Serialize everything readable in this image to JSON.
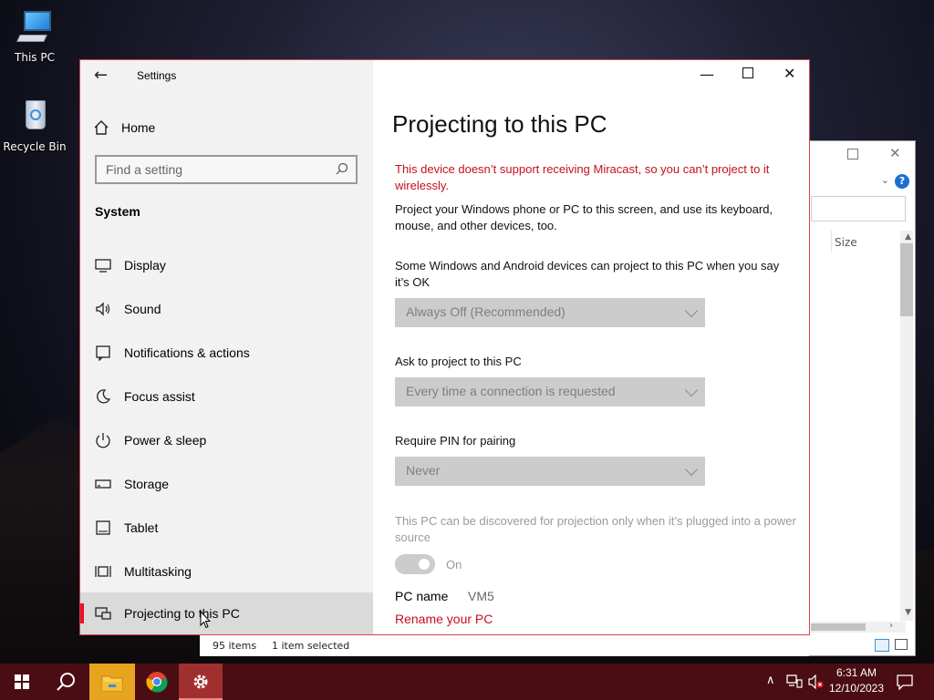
{
  "desktop": {
    "icons": [
      {
        "label": "This PC"
      },
      {
        "label": "Recycle Bin"
      }
    ]
  },
  "explorer": {
    "column_size": "Size",
    "status_items": "95 items",
    "status_selected": "1 item selected"
  },
  "settings": {
    "app_title": "Settings",
    "home_label": "Home",
    "search_placeholder": "Find a setting",
    "section_label": "System",
    "nav": [
      {
        "label": "Display",
        "icon": "monitor-icon"
      },
      {
        "label": "Sound",
        "icon": "speaker-icon"
      },
      {
        "label": "Notifications & actions",
        "icon": "notification-icon"
      },
      {
        "label": "Focus assist",
        "icon": "moon-icon"
      },
      {
        "label": "Power & sleep",
        "icon": "power-icon"
      },
      {
        "label": "Storage",
        "icon": "storage-icon"
      },
      {
        "label": "Tablet",
        "icon": "tablet-icon"
      },
      {
        "label": "Multitasking",
        "icon": "multitasking-icon"
      },
      {
        "label": "Projecting to this PC",
        "icon": "projecting-icon",
        "active": true
      }
    ],
    "page": {
      "title": "Projecting to this PC",
      "warning": "This device doesn’t support receiving Miracast, so you can’t project to it wirelessly.",
      "intro": "Project your Windows phone or PC to this screen, and use its keyboard, mouse, and other devices, too.",
      "setting1_label": "Some Windows and Android devices can project to this PC when you say it’s OK",
      "setting1_value": "Always Off (Recommended)",
      "setting2_label": "Ask to project to this PC",
      "setting2_value": "Every time a connection is requested",
      "setting3_label": "Require PIN for pairing",
      "setting3_value": "Never",
      "power_note": "This PC can be discovered for projection only when it’s plugged into a power source",
      "toggle_label": "On",
      "toggle_on": true,
      "pcname_label": "PC name",
      "pcname_value": "VM5",
      "rename_link": "Rename your PC"
    },
    "accent_color": "#c50f1f"
  },
  "taskbar": {
    "apps": [
      "start-icon",
      "search-icon",
      "file-explorer-icon",
      "chrome-icon",
      "settings-icon"
    ],
    "time": "6:31 AM",
    "date": "12/10/2023"
  }
}
